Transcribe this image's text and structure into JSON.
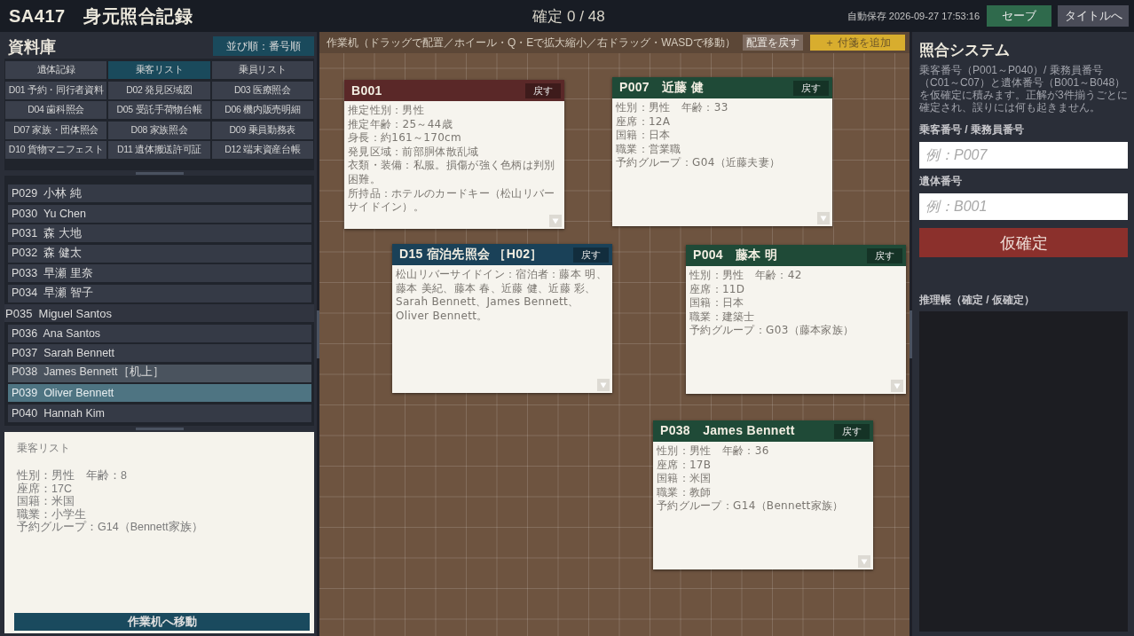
{
  "header": {
    "title": "SA417　身元照合記録",
    "progress": "確定 0 / 48",
    "autosave": "自動保存 2026-09-27 17:53:16",
    "buttons": [
      {
        "label": "セーブ",
        "kind": "save"
      },
      {
        "label": "タイトルへ",
        "kind": "title"
      }
    ]
  },
  "library": {
    "title": "資料庫",
    "sort_button": "並び順：番号順",
    "categories": [
      {
        "label": "遺体記録",
        "selected": false
      },
      {
        "label": "乗客リスト",
        "selected": true
      },
      {
        "label": "乗員リスト",
        "selected": false
      }
    ],
    "documents": [
      "D01 予約・同行者資料",
      "D02 発見区域図",
      "D03 医療照会",
      "D04 歯科照会",
      "D05 受託手荷物台帳",
      "D06 機内販売明細",
      "D07 家族・団体照会",
      "D08 家族照会",
      "D09 乗員勤務表",
      "D10 貨物マニフェスト",
      "D11 遺体搬送許可証",
      "D12 端末資産台帳"
    ],
    "entries": [
      {
        "label": "P029  小林 純",
        "selected": false,
        "on_desk": false,
        "dragging": false
      },
      {
        "label": "P030  Yu Chen",
        "selected": false,
        "on_desk": false,
        "dragging": false
      },
      {
        "label": "P031  森 大地",
        "selected": false,
        "on_desk": false,
        "dragging": false
      },
      {
        "label": "P032  森 健太",
        "selected": false,
        "on_desk": false,
        "dragging": false
      },
      {
        "label": "P033  早瀬 里奈",
        "selected": false,
        "on_desk": false,
        "dragging": false
      },
      {
        "label": "P034  早瀬 智子",
        "selected": false,
        "on_desk": false,
        "dragging": false
      },
      {
        "label": "P035  Miguel Santos",
        "selected": false,
        "on_desk": false,
        "dragging": true
      },
      {
        "label": "P036  Ana Santos",
        "selected": false,
        "on_desk": false,
        "dragging": false
      },
      {
        "label": "P037  Sarah Bennett",
        "selected": false,
        "on_desk": false,
        "dragging": false
      },
      {
        "label": "P038  James Bennett［机上］",
        "selected": false,
        "on_desk": true,
        "dragging": false
      },
      {
        "label": "P039  Oliver Bennett",
        "selected": true,
        "on_desk": false,
        "dragging": false
      },
      {
        "label": "P040  Hannah Kim",
        "selected": false,
        "on_desk": false,
        "dragging": false
      }
    ],
    "detail": {
      "heading": "乗客リスト",
      "lines": [
        "性別：男性　年齢：8",
        "座席：17C",
        "国籍：米国",
        "職業：小学生",
        "予約グループ：G14（Bennett家族）"
      ]
    },
    "move_button": "作業机へ移動"
  },
  "desk": {
    "hint": "作業机（ドラッグで配置／ホイール・Q・Eで拡大縮小／右ドラッグ・WASDで移動）",
    "buttons": [
      {
        "label": "配置を戻す",
        "kind": "reset"
      },
      {
        "label": "＋ 付箋を追加",
        "kind": "note"
      }
    ],
    "cards": [
      {
        "kind": "remains",
        "title": "B001",
        "button": "戻す",
        "lines": [
          "推定性別：男性",
          "推定年齢：25～44歳",
          "身長：約161～170cm",
          "発見区域：前部胴体散乱域",
          "衣類・装備：私服。損傷が強く色柄は判別困難。",
          "所持品：ホテルのカードキー（松山リバーサイドイン）。"
        ]
      },
      {
        "kind": "passenger",
        "title": "P007　近藤 健",
        "button": "戻す",
        "lines": [
          "性別：男性　年齢：33",
          "座席：12A",
          "国籍：日本",
          "職業：営業職",
          "予約グループ：G04（近藤夫妻）"
        ]
      },
      {
        "kind": "document",
        "title": "D15 宿泊先照会 ［H02］",
        "button": "戻す",
        "lines": [
          "松山リバーサイドイン：宿泊者：藤本 明、藤本 美紀、藤本 春、近藤 健、近藤 彩、Sarah Bennett、James Bennett、Oliver Bennett。"
        ]
      },
      {
        "kind": "passenger",
        "title": "P004　藤本 明",
        "button": "戻す",
        "lines": [
          "性別：男性　年齢：42",
          "座席：11D",
          "国籍：日本",
          "職業：建築士",
          "予約グループ：G03（藤本家族）"
        ]
      },
      {
        "kind": "passenger",
        "title": "P038　James Bennett",
        "button": "戻す",
        "lines": [
          "性別：男性　年齢：36",
          "座席：17B",
          "国籍：米国",
          "職業：教師",
          "予約グループ：G14（Bennett家族）"
        ]
      }
    ]
  },
  "match_system": {
    "title": "照合システム",
    "description": "乗客番号（P001～P040）/ 乗務員番号（C01～C07）と遺体番号（B001～B048）を仮確定に積みます。正解が3件揃うごとに確定され、誤りには何も起きません。",
    "fields": [
      {
        "label": "乗客番号 / 乗務員番号",
        "placeholder": "例：P007"
      },
      {
        "label": "遺体番号",
        "placeholder": "例：B001"
      }
    ],
    "confirm_button": "仮確定",
    "notes_label": "推理帳（確定 / 仮確定）"
  }
}
